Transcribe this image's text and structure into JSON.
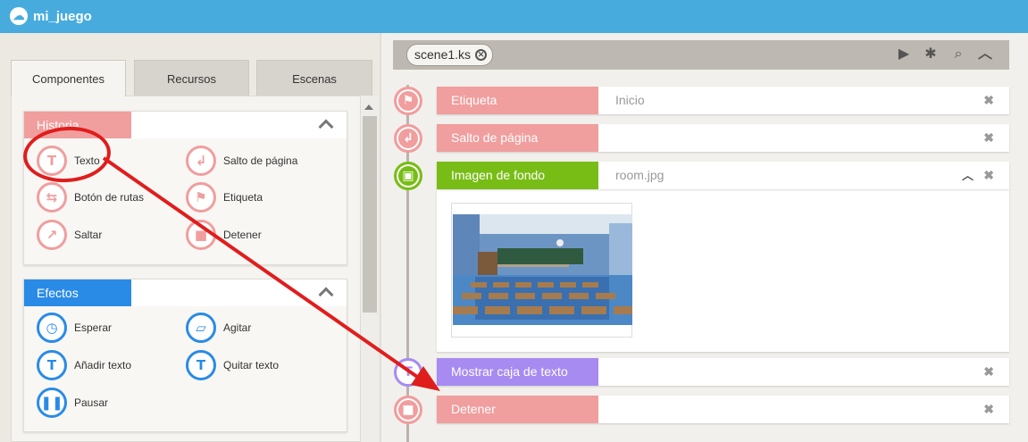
{
  "app": {
    "title": "mi_juego"
  },
  "tabs": [
    {
      "label": "Componentes",
      "active": true
    },
    {
      "label": "Recursos",
      "active": false
    },
    {
      "label": "Escenas",
      "active": false
    }
  ],
  "sections": {
    "historia": {
      "label": "Historia",
      "color": "#f09e9e",
      "items": [
        {
          "label": "Texto",
          "icon": "text-icon"
        },
        {
          "label": "Salto de página",
          "icon": "page-break-icon"
        },
        {
          "label": "Botón de rutas",
          "icon": "route-button-icon"
        },
        {
          "label": "Etiqueta",
          "icon": "flag-icon"
        },
        {
          "label": "Saltar",
          "icon": "jump-icon"
        },
        {
          "label": "Detener",
          "icon": "stop-icon"
        }
      ]
    },
    "efectos": {
      "label": "Efectos",
      "color": "#2a8be6",
      "items": [
        {
          "label": "Esperar",
          "icon": "clock-icon"
        },
        {
          "label": "Agitar",
          "icon": "shake-icon"
        },
        {
          "label": "Añadir texto",
          "icon": "add-text-icon"
        },
        {
          "label": "Quitar texto",
          "icon": "remove-text-icon"
        },
        {
          "label": "Pausar",
          "icon": "pause-icon"
        }
      ]
    }
  },
  "scene": {
    "tab_label": "scene1.ks",
    "toolbar": [
      "play-icon",
      "bug-icon",
      "search-icon",
      "collapse-icon"
    ]
  },
  "commands": [
    {
      "name": "Etiqueta",
      "value": "Inicio",
      "color": "#f09e9e",
      "icon": "flag-icon"
    },
    {
      "name": "Salto de página",
      "value": "",
      "color": "#f09e9e",
      "icon": "page-break-icon"
    },
    {
      "name": "Imagen de fondo",
      "value": "room.jpg",
      "color": "#78bd16",
      "icon": "image-icon",
      "expanded": true,
      "thumbnail": "classroom"
    },
    {
      "name": "Mostrar caja de texto",
      "value": "",
      "color": "#a78bf0",
      "icon": "show-textbox-icon"
    },
    {
      "name": "Detener",
      "value": "",
      "color": "#f09e9e",
      "icon": "stop-icon"
    }
  ],
  "annotation": {
    "highlight": "Texto",
    "arrow_target": "Detener"
  }
}
